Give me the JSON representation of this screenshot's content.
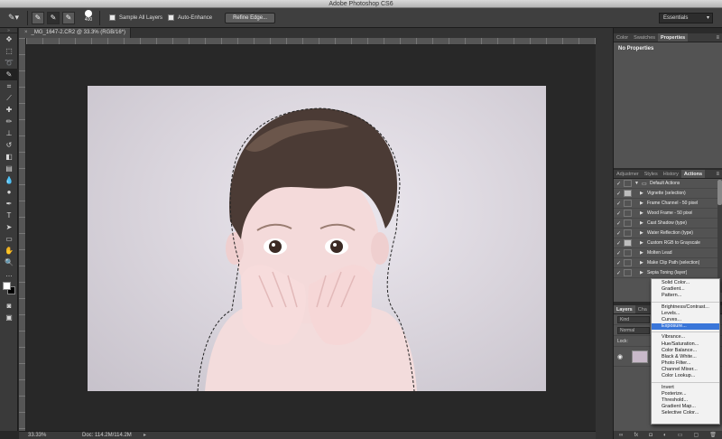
{
  "app": {
    "title": "Adobe Photoshop CS6"
  },
  "options": {
    "brush_size": "400",
    "sample_all_layers": "Sample All Layers",
    "auto_enhance": "Auto-Enhance",
    "refine_edge": "Refine Edge...",
    "workspace": "Essentials"
  },
  "document": {
    "tab_title": "_MG_1647-2.CR2 @ 33.3% (RGB/16*)",
    "zoom": "33.33%",
    "doc_size": "Doc: 114.2M/114.2M"
  },
  "properties_panel": {
    "tabs": [
      "Color",
      "Swatches",
      "Properties"
    ],
    "active_tab": "Properties",
    "content": "No Properties"
  },
  "actions_panel": {
    "tabs": [
      "Adjustmer",
      "Styles",
      "History",
      "Actions"
    ],
    "active_tab": "Actions",
    "set_name": "Default Actions",
    "items": [
      "Vignette (selection)",
      "Frame Channel - 50 pixel",
      "Wood Frame - 50 pixel",
      "Cast Shadow (type)",
      "Water Reflection (type)",
      "Custom RGB to Grayscale",
      "Molten Lead",
      "Make Clip Path (selection)",
      "Sepia Toning (layer)"
    ]
  },
  "layers_panel": {
    "tabs": [
      "Layers",
      "Cha"
    ],
    "kind": "Kind",
    "blend_mode": "Normal",
    "lock_label": "Lock:"
  },
  "adjustment_menu": {
    "highlighted": "Exposure...",
    "groups": [
      [
        "Solid Color...",
        "Gradient...",
        "Pattern..."
      ],
      [
        "Brightness/Contrast...",
        "Levels...",
        "Curves...",
        "Exposure..."
      ],
      [
        "Vibrance...",
        "Hue/Saturation...",
        "Color Balance...",
        "Black & White...",
        "Photo Filter...",
        "Channel Mixer...",
        "Color Lookup..."
      ],
      [
        "Invert",
        "Posterize...",
        "Threshold...",
        "Gradient Map...",
        "Selective Color..."
      ]
    ]
  },
  "tools": [
    "move-tool",
    "marquee-tool",
    "lasso-tool",
    "quick-selection-tool",
    "crop-tool",
    "eyedropper-tool",
    "spot-healing-tool",
    "brush-tool",
    "clone-stamp-tool",
    "history-brush-tool",
    "eraser-tool",
    "gradient-tool",
    "blur-tool",
    "dodge-tool",
    "pen-tool",
    "type-tool",
    "path-selection-tool",
    "rectangle-tool",
    "hand-tool",
    "zoom-tool"
  ],
  "colors": {
    "foreground": "#ffffff",
    "background": "#000000",
    "menu_highlight": "#3a76d9"
  }
}
